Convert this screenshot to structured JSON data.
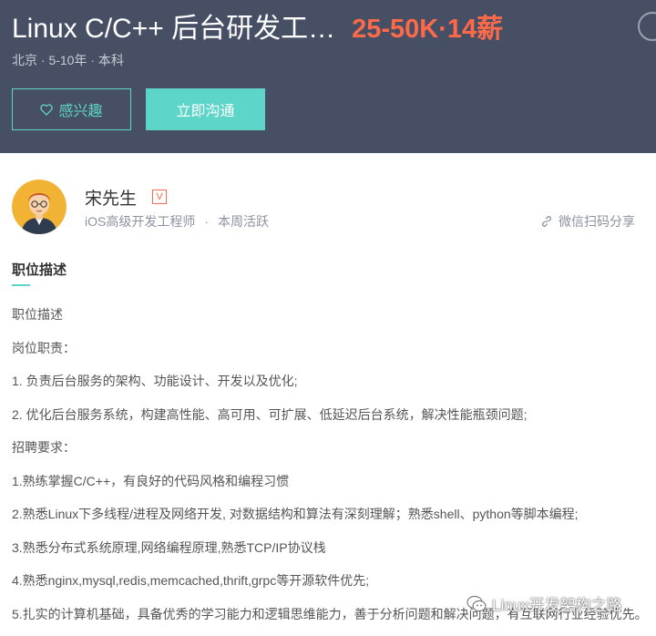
{
  "job": {
    "title": "Linux C/C++ 后台研发工…",
    "salary": "25-50K·14薪",
    "meta": "北京 · 5-10年 · 本科"
  },
  "actions": {
    "interest_label": "感兴趣",
    "chat_label": "立即沟通"
  },
  "recruiter": {
    "name": "宋先生",
    "badge": "V",
    "position": "iOS高级开发工程师",
    "separator": "·",
    "activity": "本周活跃"
  },
  "share": {
    "label": "微信扫码分享"
  },
  "section": {
    "title": "职位描述"
  },
  "description": [
    "职位描述",
    "岗位职责：",
    "1. 负责后台服务的架构、功能设计、开发以及优化;",
    "2. 优化后台服务系统，构建高性能、高可用、可扩展、低延迟后台系统，解决性能瓶颈问题;",
    "招聘要求：",
    "1.熟练掌握C/C++，有良好的代码风格和编程习惯",
    "2.熟悉Linux下多线程/进程及网络开发, 对数据结构和算法有深刻理解；熟悉shell、python等脚本编程;",
    "3.熟悉分布式系统原理,网络编程原理,熟悉TCP/IP协议栈",
    "4.熟悉nginx,mysql,redis,memcached,thrift,grpc等开源软件优先;",
    "5.扎实的计算机基础，具备优秀的学习能力和逻辑思维能力，善于分析问题和解决问题，有互联网行业经验优先。"
  ],
  "watermark": {
    "text": "Linux开发架构之路"
  },
  "icons": {
    "heart": "heart-icon",
    "link": "link-icon",
    "wechat": "wechat-icon",
    "avatar": "avatar-illustration"
  },
  "colors": {
    "header_bg": "#474f64",
    "salary": "#fc6a4a",
    "accent": "#5dd5c8"
  }
}
